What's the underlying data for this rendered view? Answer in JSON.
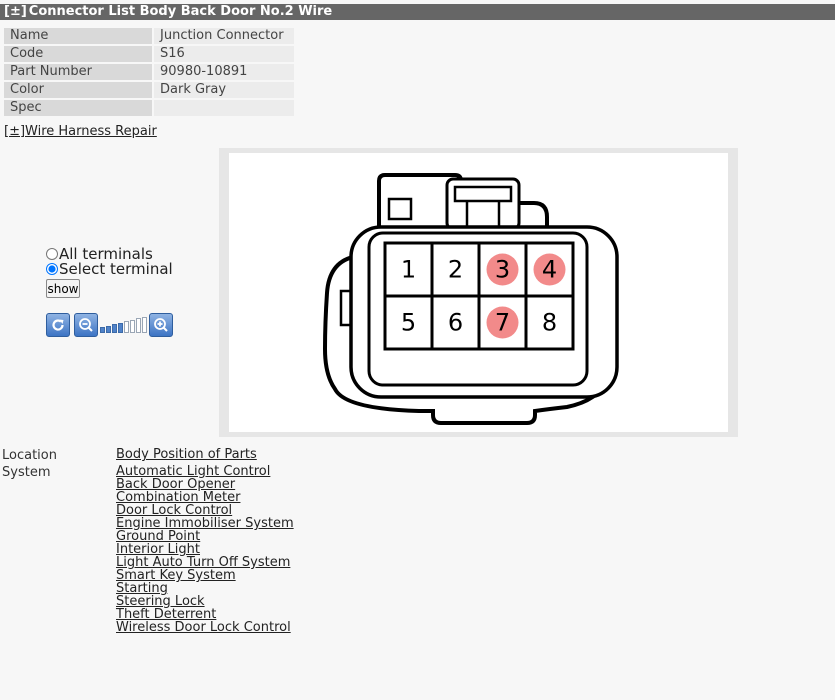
{
  "header": {
    "toggle": "[±]",
    "title": "Connector List  Body  Back Door No.2 Wire"
  },
  "properties": [
    {
      "key": "Name",
      "value": "Junction Connector"
    },
    {
      "key": "Code",
      "value": "S16"
    },
    {
      "key": "Part Number",
      "value": "90980-10891"
    },
    {
      "key": "Color",
      "value": "Dark Gray"
    },
    {
      "key": "Spec",
      "value": ""
    }
  ],
  "harness_link": "[±]Wire Harness Repair",
  "terminal_filter": {
    "all_label": "All terminals",
    "select_label": "Select terminal",
    "selected": "select",
    "show_button": "show"
  },
  "zoom": {
    "level": 4,
    "max_level": 8
  },
  "connector": {
    "terminals": [
      "1",
      "2",
      "3",
      "4",
      "5",
      "6",
      "7",
      "8"
    ],
    "highlighted": [
      "3",
      "4",
      "7"
    ],
    "highlight_color": "#f28a8a"
  },
  "location": {
    "label": "Location",
    "value": "Body  Position of Parts"
  },
  "system": {
    "label": "System",
    "items": [
      "Automatic Light Control",
      "Back Door Opener",
      "Combination Meter",
      "Door Lock Control",
      "Engine Immobiliser System",
      "Ground Point",
      "Interior Light",
      "Light Auto Turn Off System",
      "Smart Key System",
      "Starting",
      "Steering Lock",
      "Theft Deterrent",
      "Wireless Door Lock Control"
    ]
  }
}
